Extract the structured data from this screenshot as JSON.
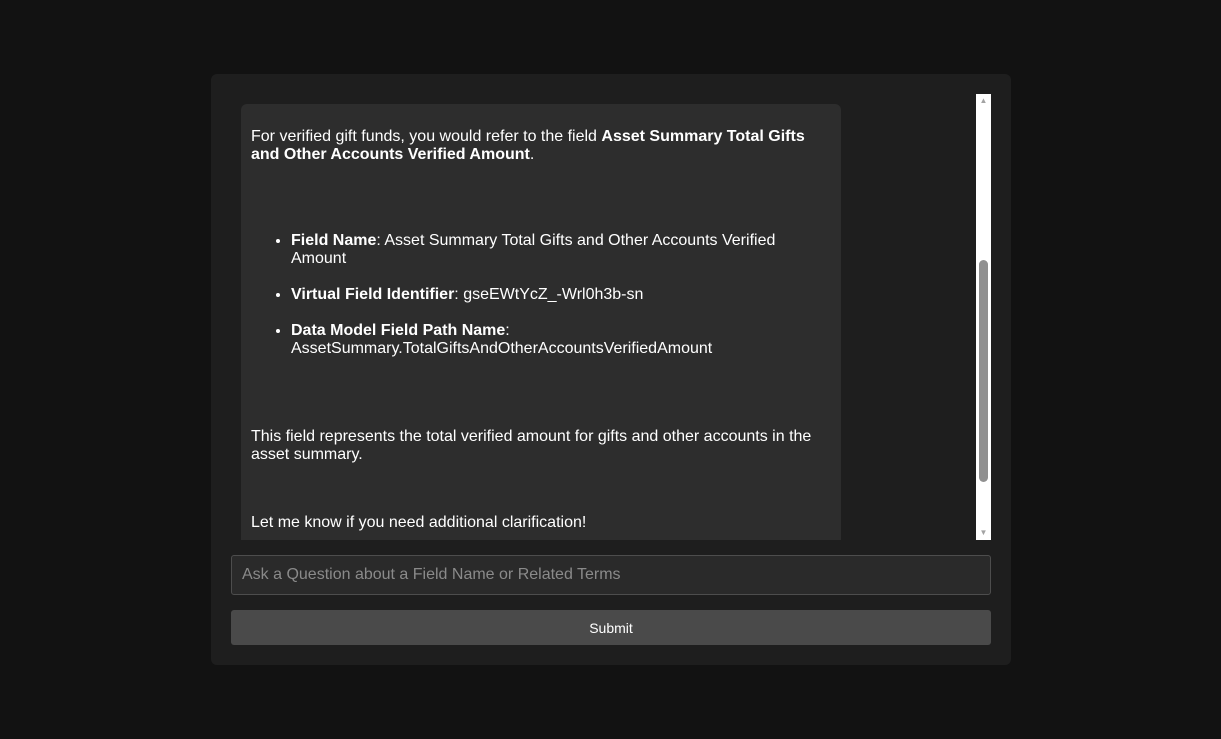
{
  "chat": {
    "message": {
      "intro_text": "For verified gift funds, you would refer to the field ",
      "intro_field": "Asset Summary Total Gifts and Other Accounts Verified Amount",
      "intro_end": ".",
      "details": [
        {
          "label": "Field Name",
          "value": ": Asset Summary Total Gifts and Other Accounts Verified Amount"
        },
        {
          "label": "Virtual Field Identifier",
          "value": ": gseEWtYcZ_-Wrl0h3b-sn"
        },
        {
          "label": "Data Model Field Path Name",
          "value": ": AssetSummary.TotalGiftsAndOtherAccountsVerifiedAmount"
        }
      ],
      "description": "This field represents the total verified amount for gifts and other accounts in the asset summary.",
      "closing": "Let me know if you need additional clarification!"
    }
  },
  "input": {
    "placeholder": "Ask a Question about a Field Name or Related Terms",
    "value": ""
  },
  "submit": {
    "label": "Submit"
  },
  "scrollbar": {
    "up_arrow_icon": "triangle-up-icon",
    "down_arrow_icon": "triangle-down-icon"
  }
}
